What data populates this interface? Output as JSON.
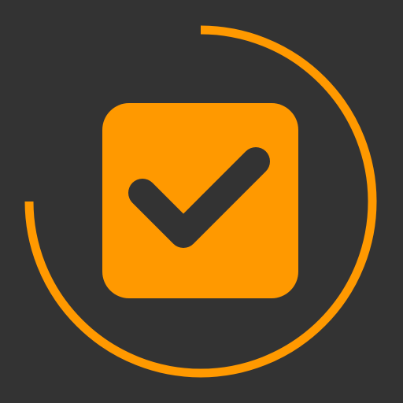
{
  "icon": {
    "ring_icon_name": "progress-ring-icon",
    "checkbox_icon_name": "checked-checkbox-icon",
    "checkmark_icon_name": "checkmark-icon",
    "progress_fraction": 0.75
  },
  "colors": {
    "background": "#333333",
    "accent": "#FF9900",
    "checkmark": "#333333"
  }
}
